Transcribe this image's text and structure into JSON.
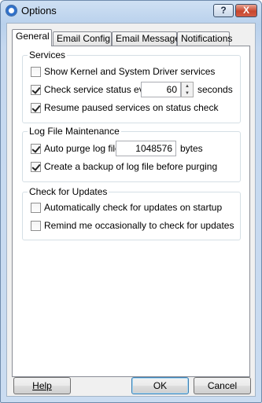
{
  "window": {
    "title": "Options",
    "help_button": "?",
    "close_button": "X"
  },
  "tabs": [
    "General",
    "Email Config",
    "Email Message",
    "Notifications"
  ],
  "services": {
    "title": "Services",
    "show_kernel": "Show Kernel and System Driver services",
    "check_status": "Check service status every",
    "check_interval": "60",
    "seconds": "seconds",
    "resume_paused": "Resume paused services on status check"
  },
  "log": {
    "title": "Log File Maintenance",
    "auto_purge": "Auto purge log file at",
    "purge_size": "1048576",
    "bytes": "bytes",
    "backup": "Create a backup of log file before purging"
  },
  "updates": {
    "title": "Check for Updates",
    "auto_check": "Automatically check for updates on startup",
    "remind": "Remind me occasionally to check for updates"
  },
  "buttons": {
    "help": "Help",
    "ok": "OK",
    "cancel": "Cancel"
  }
}
